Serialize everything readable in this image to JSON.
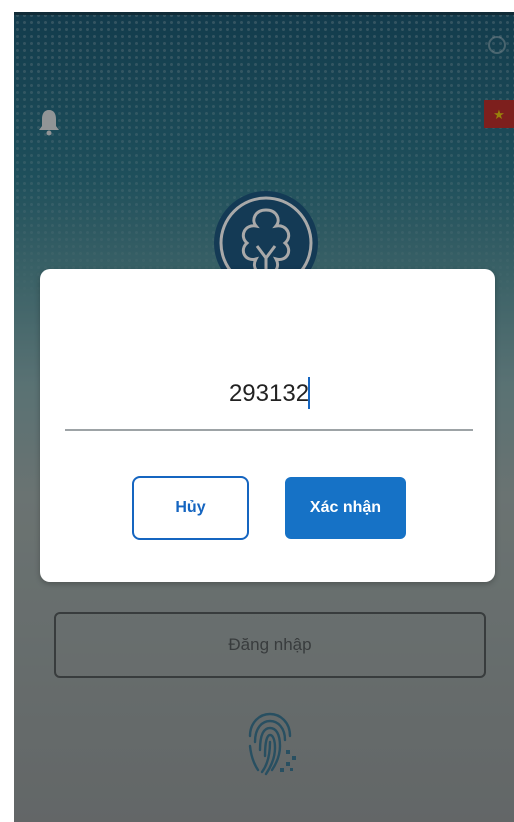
{
  "colors": {
    "primary": "#1672c6",
    "header_bg": "#0e4f6a",
    "flag_red": "#b9211e",
    "flag_star": "#e6c000",
    "overlay": "rgba(30,30,30,0.38)"
  },
  "header": {
    "left_icon": "bell-icon",
    "right_icon": "flag-vietnam-icon",
    "logo": "social-insurance-logo"
  },
  "otp_dialog": {
    "input_value": "293132",
    "cancel_label": "Hủy",
    "confirm_label": "Xác nhận"
  },
  "login": {
    "login_label": "Đăng nhập",
    "biometric_icon": "fingerprint-icon"
  }
}
